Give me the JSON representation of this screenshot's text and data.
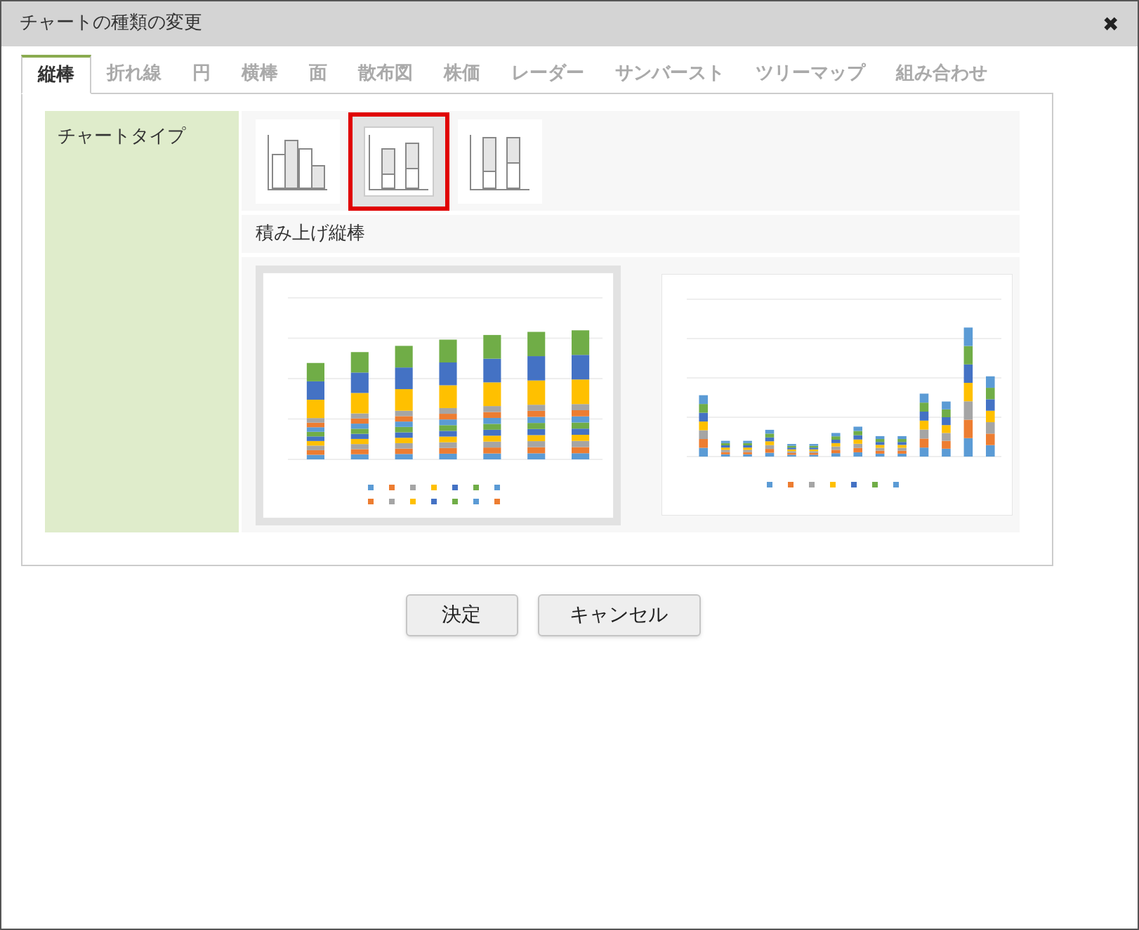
{
  "window": {
    "title": "チャートの種類の変更",
    "close": "✖"
  },
  "tabs": [
    {
      "label": "縦棒",
      "selected": true
    },
    {
      "label": "折れ線",
      "selected": false
    },
    {
      "label": "円",
      "selected": false
    },
    {
      "label": "横棒",
      "selected": false
    },
    {
      "label": "面",
      "selected": false
    },
    {
      "label": "散布図",
      "selected": false
    },
    {
      "label": "株価",
      "selected": false
    },
    {
      "label": "レーダー",
      "selected": false
    },
    {
      "label": "サンバースト",
      "selected": false
    },
    {
      "label": "ツリーマップ",
      "selected": false
    },
    {
      "label": "組み合わせ",
      "selected": false
    }
  ],
  "chart_type_label": "チャートタイプ",
  "subtypes": [
    {
      "kind": "clustered",
      "selected": false
    },
    {
      "kind": "stacked",
      "selected": true
    },
    {
      "kind": "percent",
      "selected": false
    }
  ],
  "subtype_caption": "積み上げ縦棒",
  "previews": [
    {
      "kind": "by-year",
      "selected": true
    },
    {
      "kind": "by-region",
      "selected": false
    }
  ],
  "buttons": [
    "決定",
    "キャンセル"
  ]
}
